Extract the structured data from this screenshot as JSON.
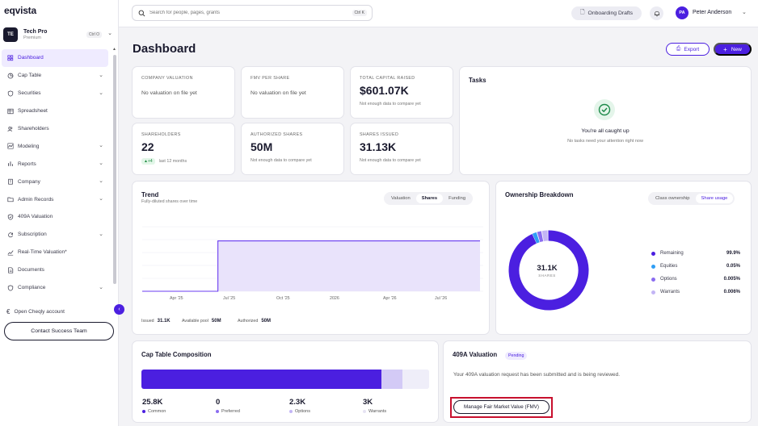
{
  "app": {
    "logo": "eqvista"
  },
  "company": {
    "initials": "TE",
    "name": "Tech Pro",
    "plan": "Premium",
    "shortcut": "Ctrl O"
  },
  "sidebar": {
    "items": [
      {
        "label": "Dashboard",
        "icon": "grid-icon",
        "chevron": false,
        "active": true
      },
      {
        "label": "Cap Table",
        "icon": "pie-chart-icon",
        "chevron": true,
        "active": false
      },
      {
        "label": "Securities",
        "icon": "shield-icon",
        "chevron": true,
        "active": false
      },
      {
        "label": "Spreadsheet",
        "icon": "table-icon",
        "chevron": false,
        "active": false
      },
      {
        "label": "Shareholders",
        "icon": "users-icon",
        "chevron": false,
        "active": false
      },
      {
        "label": "Modeling",
        "icon": "modeling-icon",
        "chevron": true,
        "active": false
      },
      {
        "label": "Reports",
        "icon": "bar-chart-icon",
        "chevron": true,
        "active": false
      },
      {
        "label": "Company",
        "icon": "building-icon",
        "chevron": true,
        "active": false
      },
      {
        "label": "Admin Records",
        "icon": "folder-icon",
        "chevron": true,
        "active": false
      },
      {
        "label": "409A Valuation",
        "icon": "shield-check-icon",
        "chevron": false,
        "active": false
      },
      {
        "label": "Subscription",
        "icon": "refresh-icon",
        "chevron": true,
        "active": false
      },
      {
        "label": "Real-Time Valuation*",
        "icon": "trend-line-icon",
        "chevron": false,
        "active": false
      },
      {
        "label": "Documents",
        "icon": "document-icon",
        "chevron": false,
        "active": false
      },
      {
        "label": "Compliance",
        "icon": "shield-icon",
        "chevron": true,
        "active": false
      }
    ],
    "open_link": "Open Cheqly account",
    "contact_button": "Contact Success Team"
  },
  "topbar": {
    "search_placeholder": "Search for people, pages, grants",
    "search_shortcut": "Ctrl K",
    "drafts_label": "Onboarding Drafts",
    "user_initials": "PA",
    "user_name": "Peter Anderson"
  },
  "page": {
    "title": "Dashboard",
    "export_label": "Export",
    "new_label": "New"
  },
  "kpis": {
    "company_valuation": {
      "label": "COMPANY VALUATION",
      "text": "No valuation on file yet"
    },
    "fmv_per_share": {
      "label": "FMV PER SHARE",
      "text": "No valuation on file yet"
    },
    "total_capital": {
      "label": "TOTAL CAPITAL RAISED",
      "value": "$601.07K",
      "sub": "Not enough data to compare yet"
    },
    "shareholders": {
      "label": "SHAREHOLDERS",
      "value": "22",
      "badge": "▲+4",
      "sub": "last 12 months"
    },
    "authorized_shares": {
      "label": "AUTHORIZED SHARES",
      "value": "50M",
      "sub": "Not enough data to compare yet"
    },
    "shares_issued": {
      "label": "SHARES ISSUED",
      "value": "31.13K",
      "sub": "Not enough data to compare yet"
    }
  },
  "tasks": {
    "title": "Tasks",
    "message": "You're all caught up",
    "sub": "No tasks need your attention right now"
  },
  "trend": {
    "title": "Trend",
    "subtitle": "Fully-diluted shares over time",
    "tabs": [
      "Valuation",
      "Shares",
      "Funding"
    ],
    "active_tab": "Shares",
    "footer": [
      {
        "label": "Issued",
        "value": "31.1K"
      },
      {
        "label": "Available pool",
        "value": "50M"
      },
      {
        "label": "Authorized",
        "value": "50M"
      }
    ]
  },
  "chart_data": {
    "type": "area",
    "x_tick_labels": [
      "Apr '25",
      "Jul '25",
      "Oct '25",
      "2026",
      "Apr '26",
      "Jul '26"
    ],
    "series": [
      {
        "values": [
          0,
          0,
          31.1,
          31.1,
          31.1,
          31.1,
          31.1
        ]
      }
    ],
    "step_position": 0.25,
    "color": "#6a3cf0",
    "fill": "#e9e3fb",
    "grid": true
  },
  "ownership": {
    "title": "Ownership Breakdown",
    "tabs": [
      "Class ownership",
      "Share usage"
    ],
    "active_tab": "Share usage",
    "center_value": "31.1K",
    "center_label": "SHARES",
    "legend": [
      {
        "name": "Remaining",
        "value": "99.9%",
        "color": "#4b1fe0",
        "fraction": 0.935
      },
      {
        "name": "Equities",
        "value": "0.05%",
        "color": "#2f9ef5",
        "fraction": 0.02
      },
      {
        "name": "Options",
        "value": "0.005%",
        "color": "#8a6cf0",
        "fraction": 0.02
      },
      {
        "name": "Warrants",
        "value": "0.006%",
        "color": "#c3b5f5",
        "fraction": 0.025
      }
    ]
  },
  "cap_table": {
    "title": "Cap Table Composition",
    "segments": [
      {
        "color": "#4b1fe0",
        "fraction": 0.834
      },
      {
        "color": "#d3caf6",
        "fraction": 0.073
      },
      {
        "color": "#efeef9",
        "fraction": 0.093
      }
    ],
    "stats": [
      {
        "value": "25.8K",
        "label": "Common",
        "color": "#4b1fe0"
      },
      {
        "value": "0",
        "label": "Preferred",
        "color": "#8a6cf0"
      },
      {
        "value": "2.3K",
        "label": "Options",
        "color": "#c3b5f5"
      },
      {
        "value": "3K",
        "label": "Warrants",
        "color": "#e6e3f3"
      }
    ]
  },
  "valuation_409a": {
    "title": "409A Valuation",
    "badge": "Pending",
    "text": "Your 409A valuation request has been submitted and is being reviewed.",
    "button": "Manage Fair Market Value (FMV)"
  }
}
